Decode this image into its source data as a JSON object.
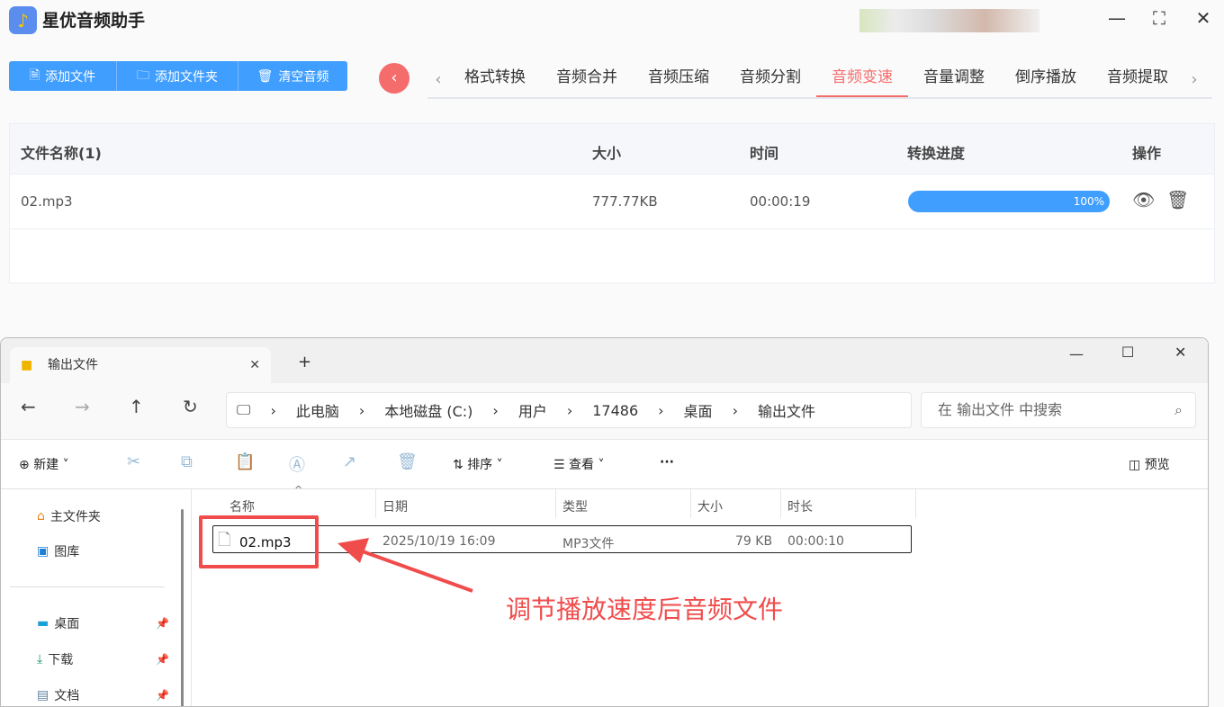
{
  "app": {
    "title": "星优音频助手"
  },
  "toolbar": {
    "add_file": "添加文件",
    "add_folder": "添加文件夹",
    "clear": "清空音频"
  },
  "tabs": [
    "格式转换",
    "音频合并",
    "音频压缩",
    "音频分割",
    "音频变速",
    "音量调整",
    "倒序播放",
    "音频提取"
  ],
  "active_tab": "音频变速",
  "table": {
    "headers": {
      "name": "文件名称(1)",
      "size": "大小",
      "time": "时间",
      "progress": "转换进度",
      "action": "操作"
    },
    "rows": [
      {
        "name": "02.mp3",
        "size": "777.77KB",
        "time": "00:00:19",
        "progress_label": "100%",
        "progress": 100
      }
    ]
  },
  "explorer": {
    "tab_title": "输出文件",
    "breadcrumbs": [
      "此电脑",
      "本地磁盘 (C:)",
      "用户",
      "17486",
      "桌面",
      "输出文件"
    ],
    "search_placeholder": "在 输出文件 中搜索",
    "toolbar": {
      "new": "新建",
      "sort": "排序",
      "view": "查看",
      "more": "···",
      "preview": "预览"
    },
    "sidebar": [
      "主文件夹",
      "图库",
      "桌面",
      "下载",
      "文档"
    ],
    "columns": [
      "名称",
      "日期",
      "类型",
      "大小",
      "时长"
    ],
    "files": [
      {
        "name": "02.mp3",
        "date": "2025/10/19 16:09",
        "type": "MP3文件",
        "size": "79 KB",
        "duration": "00:00:10"
      }
    ]
  },
  "annotation": "调节播放速度后音频文件",
  "colors": {
    "primary": "#409eff",
    "accent": "#f56c6c"
  }
}
